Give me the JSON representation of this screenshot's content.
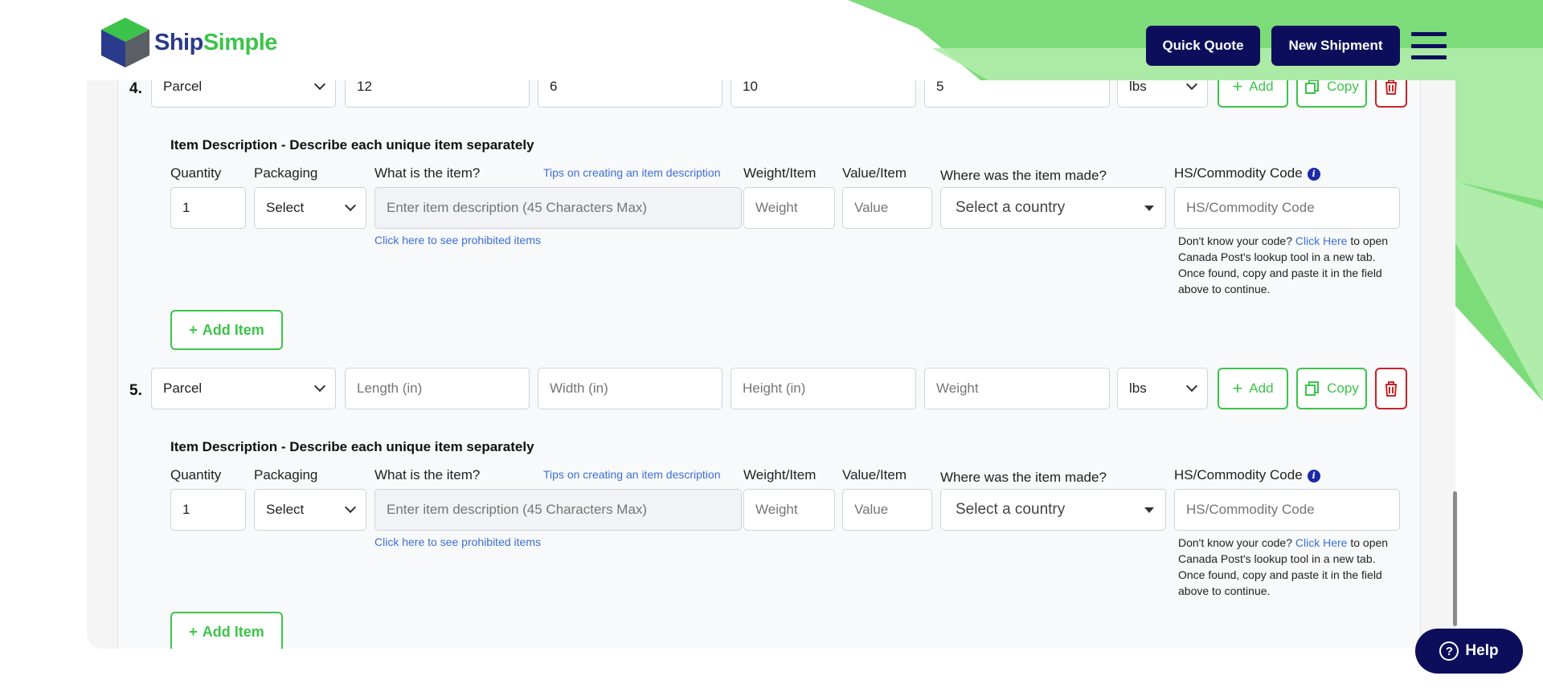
{
  "header": {
    "logo_ship": "Ship",
    "logo_simple": "Simple",
    "quick_quote": "Quick Quote",
    "new_shipment": "New Shipment"
  },
  "colors": {
    "navy": "#0c0e5c",
    "green": "#3cc44a",
    "red": "#c8242b",
    "link": "#3b6fd8"
  },
  "packages": [
    {
      "number": "4.",
      "type": "Parcel",
      "length": "12",
      "width": "6",
      "height": "10",
      "weight": "5",
      "unit": "lbs",
      "add_label": "Add",
      "copy_label": "Copy",
      "items": {
        "title": "Item Description - Describe each unique item separately",
        "quantity_label": "Quantity",
        "packaging_label": "Packaging",
        "what_label": "What is the item?",
        "tips_link": "Tips on creating an item description",
        "weight_label": "Weight/Item",
        "value_label": "Value/Item",
        "made_label": "Where was the item made?",
        "hs_label": "HS/Commodity Code",
        "quantity_value": "1",
        "packaging_value": "Select",
        "description_placeholder": "Enter item description (45 Characters Max)",
        "weight_placeholder": "Weight",
        "value_placeholder": "Value",
        "country_value": "Select a country",
        "hs_placeholder": "HS/Commodity Code",
        "prohibited_link": "Click here to see prohibited items",
        "hs_help_pre": "Don't know your code?",
        "hs_help_link": "Click Here",
        "hs_help_post": "to open Canada Post's lookup tool in a new tab. Once found, copy and paste it in the field above to continue.",
        "add_item": "Add Item"
      }
    },
    {
      "number": "5.",
      "type": "Parcel",
      "length_placeholder": "Length (in)",
      "width_placeholder": "Width (in)",
      "height_placeholder": "Height (in)",
      "weight_placeholder": "Weight",
      "unit": "lbs",
      "add_label": "Add",
      "copy_label": "Copy",
      "items": {
        "title": "Item Description - Describe each unique item separately",
        "quantity_label": "Quantity",
        "packaging_label": "Packaging",
        "what_label": "What is the item?",
        "tips_link": "Tips on creating an item description",
        "weight_label": "Weight/Item",
        "value_label": "Value/Item",
        "made_label": "Where was the item made?",
        "hs_label": "HS/Commodity Code",
        "quantity_value": "1",
        "packaging_value": "Select",
        "description_placeholder": "Enter item description (45 Characters Max)",
        "weight_placeholder": "Weight",
        "value_placeholder": "Value",
        "country_value": "Select a country",
        "hs_placeholder": "HS/Commodity Code",
        "prohibited_link": "Click here to see prohibited items",
        "hs_help_pre": "Don't know your code?",
        "hs_help_link": "Click Here",
        "hs_help_post": "to open Canada Post's lookup tool in a new tab. Once found, copy and paste it in the field above to continue.",
        "add_item": "Add Item"
      }
    }
  ],
  "help": {
    "label": "Help"
  }
}
